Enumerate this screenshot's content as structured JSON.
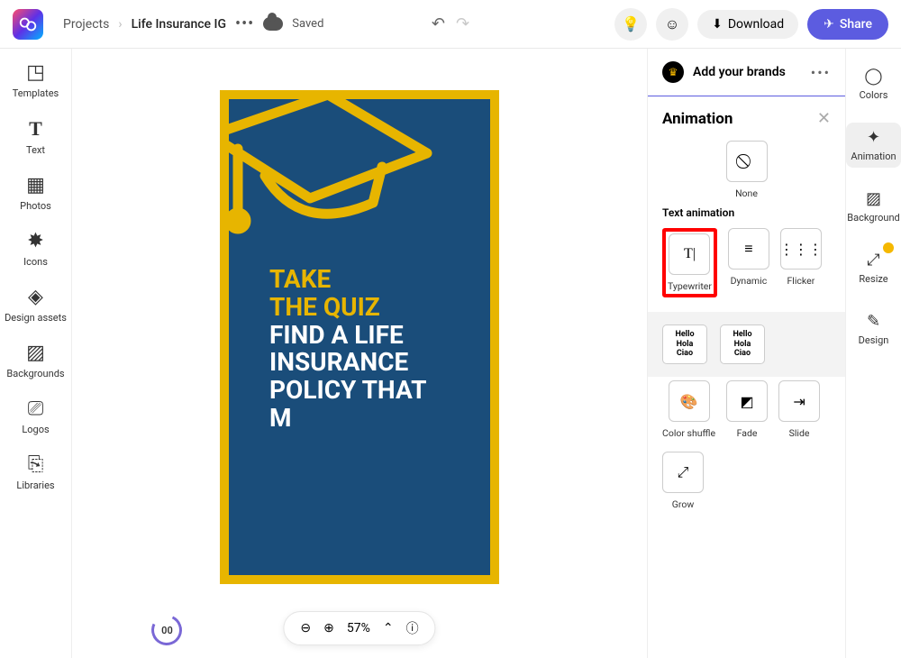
{
  "header": {
    "breadcrumb_root": "Projects",
    "project_name": "Life Insurance IG",
    "saved_label": "Saved",
    "download_label": "Download",
    "share_label": "Share"
  },
  "left_nav": [
    {
      "label": "Templates"
    },
    {
      "label": "Text"
    },
    {
      "label": "Photos"
    },
    {
      "label": "Icons"
    },
    {
      "label": "Design assets"
    },
    {
      "label": "Backgrounds"
    },
    {
      "label": "Logos"
    },
    {
      "label": "Libraries"
    }
  ],
  "canvas": {
    "line1": "TAKE",
    "line2": "THE QUIZ",
    "line3": "FIND A LIFE",
    "line4": "INSURANCE",
    "line5": "POLICY THAT",
    "line6": "M",
    "timer": "00",
    "zoom": "57%"
  },
  "panel": {
    "brands_label": "Add your brands",
    "title": "Animation",
    "none_label": "None",
    "section_label": "Text animation",
    "opts": {
      "typewriter": "Typewriter",
      "dynamic": "Dynamic",
      "flicker": "Flicker",
      "color_shuffle": "Color shuffle",
      "fade": "Fade",
      "slide": "Slide",
      "grow": "Grow"
    },
    "lang": {
      "l1": "Hello",
      "l2": "Hola",
      "l3": "Ciao"
    }
  },
  "right_nav": [
    {
      "label": "Colors"
    },
    {
      "label": "Animation"
    },
    {
      "label": "Background"
    },
    {
      "label": "Resize"
    },
    {
      "label": "Design"
    }
  ]
}
